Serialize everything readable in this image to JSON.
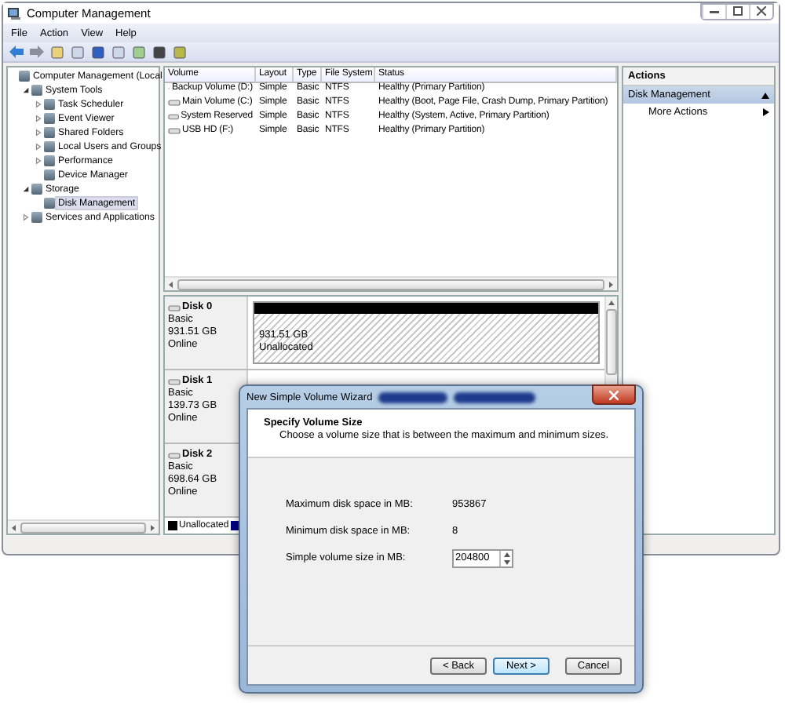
{
  "window": {
    "title": "Computer Management"
  },
  "menu": [
    {
      "label": "File"
    },
    {
      "label": "Action"
    },
    {
      "label": "View"
    },
    {
      "label": "Help"
    }
  ],
  "tree": [
    {
      "label": "Computer Management (Local",
      "selected": false,
      "children": [
        {
          "label": "System Tools",
          "expanded": true,
          "selected": false,
          "children": [
            {
              "label": "Task Scheduler",
              "expanded": false,
              "selected": false
            },
            {
              "label": "Event Viewer",
              "expanded": false,
              "selected": false
            },
            {
              "label": "Shared Folders",
              "expanded": false,
              "selected": false
            },
            {
              "label": "Local Users and Groups",
              "expanded": false,
              "selected": false
            },
            {
              "label": "Performance",
              "expanded": false,
              "selected": false
            },
            {
              "label": "Device Manager",
              "selected": false
            }
          ]
        },
        {
          "label": "Storage",
          "expanded": true,
          "selected": false,
          "children": [
            {
              "label": "Disk Management",
              "selected": true
            }
          ]
        },
        {
          "label": "Services and Applications",
          "expanded": false,
          "selected": false
        }
      ]
    }
  ],
  "volumes": {
    "columns": [
      "Volume",
      "Layout",
      "Type",
      "File System",
      "Status"
    ],
    "rows": [
      [
        "Backup Volume (D:)",
        "Simple",
        "Basic",
        "NTFS",
        "Healthy (Primary Partition)"
      ],
      [
        "Main Volume (C:)",
        "Simple",
        "Basic",
        "NTFS",
        "Healthy (Boot, Page File, Crash Dump, Primary Partition)"
      ],
      [
        "System Reserved",
        "Simple",
        "Basic",
        "NTFS",
        "Healthy (System, Active, Primary Partition)"
      ],
      [
        "USB  HD (F:)",
        "Simple",
        "Basic",
        "NTFS",
        "Healthy (Primary Partition)"
      ]
    ]
  },
  "disks": [
    {
      "name": "Disk 0",
      "type": "Basic",
      "size": "931.51 GB",
      "status": "Online",
      "partitions": [
        {
          "size": "931.51 GB",
          "label": "Unallocated",
          "kind": "unallocated"
        }
      ]
    },
    {
      "name": "Disk 1",
      "type": "Basic",
      "size": "139.73 GB",
      "status": "Online"
    },
    {
      "name": "Disk 2",
      "type": "Basic",
      "size": "698.64 GB",
      "status": "Online"
    }
  ],
  "legend": [
    {
      "label": "Unallocated",
      "color": "#000000"
    },
    {
      "color": "#000080"
    }
  ],
  "actions": {
    "title": "Actions",
    "section": "Disk Management",
    "items": [
      "More Actions"
    ]
  },
  "dialog": {
    "title": "New Simple Volume Wizard",
    "heading": "Specify Volume Size",
    "subtitle": "Choose a volume size that is between the maximum and minimum sizes.",
    "fields": [
      {
        "label": "Maximum disk space in MB:",
        "value": "953867",
        "kind": "text"
      },
      {
        "label": "Minimum disk space in MB:",
        "value": "8",
        "kind": "text"
      },
      {
        "label": "Simple volume size in MB:",
        "value": "204800",
        "kind": "spinner"
      }
    ],
    "buttons": [
      {
        "label": "< Back",
        "default": false
      },
      {
        "label": "Next >",
        "default": true
      },
      {
        "label": "Cancel",
        "default": false
      }
    ]
  }
}
